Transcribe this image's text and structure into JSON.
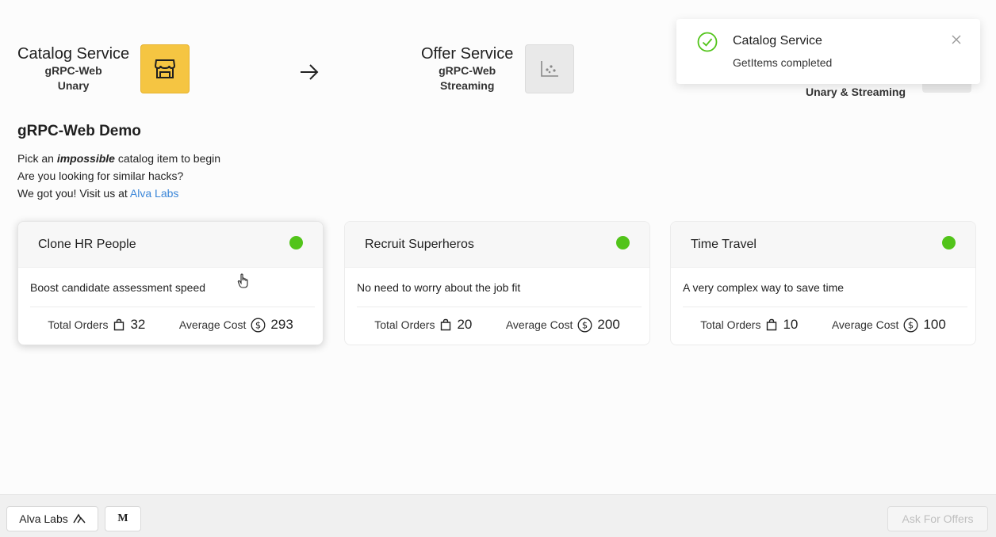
{
  "services": {
    "catalog": {
      "name": "Catalog Service",
      "protocol": "gRPC-Web",
      "mode": "Unary",
      "icon": "shop-icon"
    },
    "offer": {
      "name": "Offer Service",
      "protocol": "gRPC-Web",
      "mode": "Streaming",
      "icon": "dot-chart-icon"
    },
    "third": {
      "mode": "Unary & Streaming"
    }
  },
  "hero": {
    "title": "gRPC-Web Demo",
    "line1_pre": "Pick an ",
    "line1_em": "impossible",
    "line1_post": " catalog item to begin",
    "line2": "Are you looking for similar hacks?",
    "line3_pre": "We got you! Visit us at ",
    "link": "Alva Labs"
  },
  "cards": [
    {
      "title": "Clone HR People",
      "description": "Boost candidate assessment speed",
      "orders_label": "Total Orders",
      "orders": "32",
      "cost_label": "Average Cost",
      "cost": "293",
      "status_color": "#52c41a"
    },
    {
      "title": "Recruit Superheros",
      "description": "No need to worry about the job fit",
      "orders_label": "Total Orders",
      "orders": "20",
      "cost_label": "Average Cost",
      "cost": "200",
      "status_color": "#52c41a"
    },
    {
      "title": "Time Travel",
      "description": "A very complex way to save time",
      "orders_label": "Total Orders",
      "orders": "10",
      "cost_label": "Average Cost",
      "cost": "100",
      "status_color": "#52c41a"
    }
  ],
  "toast": {
    "title": "Catalog Service",
    "message": "GetItems completed"
  },
  "footer": {
    "brand_label": "Alva Labs",
    "medium_label": "M",
    "ask_label": "Ask For Offers"
  },
  "colors": {
    "accent": "#f5c542",
    "link": "#3b86d8",
    "success": "#52c41a"
  }
}
